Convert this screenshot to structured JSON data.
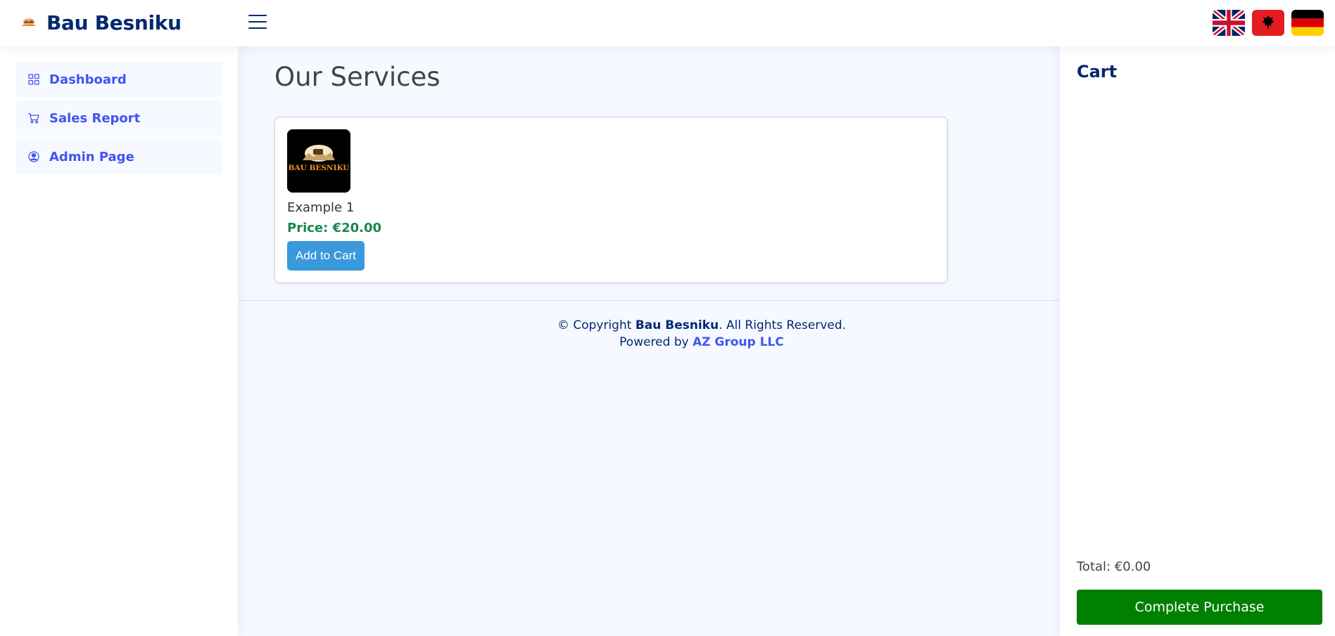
{
  "header": {
    "brand": "Bau Besniku",
    "logo_icon": "brand-logo-icon",
    "toggle_icon": "hamburger-menu-icon",
    "flags": [
      {
        "name": "flag-uk-icon",
        "language": "English"
      },
      {
        "name": "flag-albania-icon",
        "language": "Albanian"
      },
      {
        "name": "flag-germany-icon",
        "language": "German"
      }
    ]
  },
  "sidebar": {
    "items": [
      {
        "label": "Dashboard",
        "icon": "grid-icon"
      },
      {
        "label": "Sales Report",
        "icon": "cart-icon"
      },
      {
        "label": "Admin Page",
        "icon": "person-circle-icon"
      }
    ]
  },
  "main": {
    "title": "Our Services",
    "services": [
      {
        "image_text": "BAU BESNIKU",
        "name": "Example 1",
        "price": "Price: €20.00",
        "button": "Add to Cart"
      }
    ]
  },
  "footer": {
    "copyright_prefix": "© Copyright ",
    "copyright_brand": "Bau Besniku",
    "copyright_suffix": ". All Rights Reserved.",
    "powered_prefix": "Powered by ",
    "powered_link": "AZ Group LLC"
  },
  "cart": {
    "title": "Cart",
    "total": "Total: €0.00",
    "complete_button": "Complete Purchase"
  },
  "colors": {
    "brand": "#012970",
    "nav": "#4154f1",
    "price": "#198754",
    "add_button": "#3a98dc",
    "complete_button": "#008000"
  }
}
